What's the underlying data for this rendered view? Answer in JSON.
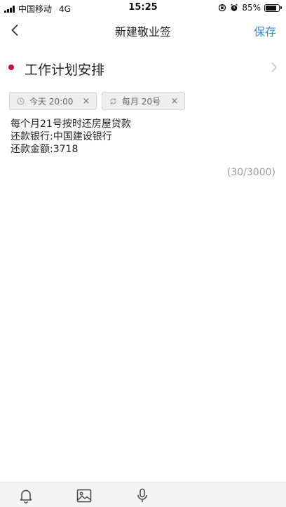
{
  "status_bar": {
    "carrier": "中国移动",
    "network": "4G",
    "time": "15:25",
    "battery_percent": "85%",
    "battery_level": 0.85
  },
  "nav": {
    "title": "新建敬业签",
    "save_label": "保存"
  },
  "category": {
    "title": "工作计划安排",
    "color": "#c8103e"
  },
  "reminder": {
    "time_label": "今天 20:00",
    "close": "×"
  },
  "repeat": {
    "label": "每月 20号",
    "close": "×"
  },
  "note": {
    "lines": [
      "每个月21号按时还房屋贷款",
      "还款银行:中国建设银行",
      "还款金额:3718"
    ],
    "char_count": "(30/3000)"
  },
  "toolbar": {
    "icons": [
      "bell-icon",
      "image-icon",
      "microphone-icon"
    ]
  },
  "colors": {
    "accent": "#3a8fd9",
    "category_dot": "#c8103e"
  }
}
